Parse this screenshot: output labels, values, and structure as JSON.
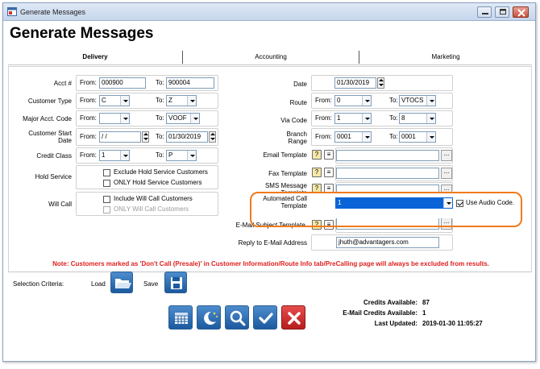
{
  "window": {
    "title": "Generate Messages"
  },
  "page": {
    "heading": "Generate Messages"
  },
  "tabs": [
    {
      "label": "Delivery",
      "active": true
    },
    {
      "label": "Accounting",
      "active": false
    },
    {
      "label": "Marketing",
      "active": false
    }
  ],
  "left": {
    "acct": {
      "label": "Acct #",
      "from_label": "From:",
      "from_value": "000900",
      "to_label": "To:",
      "to_value": "900004"
    },
    "customer_type": {
      "label": "Customer Type",
      "from_label": "From:",
      "from_value": "C",
      "to_label": "To:",
      "to_value": "Z"
    },
    "major_acct_code": {
      "label": "Major Acct. Code",
      "from_label": "From:",
      "from_value": "",
      "to_label": "To:",
      "to_value": "VOOF"
    },
    "customer_start_date": {
      "label_line1": "Customer Start",
      "label_line2": "Date",
      "from_label": "From:",
      "from_value": " / /",
      "to_label": "To:",
      "to_value": "01/30/2019"
    },
    "credit_class": {
      "label": "Credit Class",
      "from_label": "From:",
      "from_value": "1",
      "to_label": "To:",
      "to_value": "P"
    },
    "hold_service": {
      "label": "Hold Service",
      "opt1": "Exclude Hold Service Customers",
      "opt2": "ONLY Hold Service Customers"
    },
    "will_call": {
      "label": "Will Call",
      "opt1": "Include Will Call Customers",
      "opt2": "ONLY Will Call Customers"
    }
  },
  "right": {
    "date": {
      "label": "Date",
      "value": "01/30/2019"
    },
    "route": {
      "label": "Route",
      "from_label": "From:",
      "from_value": "0",
      "to_label": "To:",
      "to_value": "VTOCS"
    },
    "via_code": {
      "label": "Via Code",
      "from_label": "From:",
      "from_value": "1",
      "to_label": "To:",
      "to_value": "8"
    },
    "branch_range": {
      "label_line1": "Branch",
      "label_line2": "Range",
      "from_label": "From:",
      "from_value": "0001",
      "to_label": "To:",
      "to_value": "0001"
    },
    "email_template": {
      "label": "Email Template",
      "dots": "..."
    },
    "fax_template": {
      "label": "Fax Template",
      "dots": "..."
    },
    "sms_template": {
      "label_line1": "SMS Message",
      "label_line2": "Template",
      "dots": "..."
    },
    "automated_call": {
      "label_line1": "Automated Call",
      "label_line2": "Template",
      "value": "1",
      "checkbox_label": "Use Audio Code."
    },
    "email_subject": {
      "label": "E-Mail Subject Template.",
      "dots": "..."
    },
    "reply_to": {
      "label": "Reply to E-Mail Address",
      "value": "jhuth@advantagers.com"
    }
  },
  "note": "Note: Customers marked as 'Don't Call (Presale)' in Customer Information/Route Info tab/PreCalling page will always be excluded from results.",
  "criteria": {
    "label": "Selection Criteria:",
    "load_label": "Load",
    "save_label": "Save"
  },
  "credits": {
    "available_label": "Credits Available:",
    "available_value": "87",
    "email_label": "E-Mail Credits Available:",
    "email_value": "1",
    "updated_label": "Last Updated:",
    "updated_value": "2019-01-30 11:05:27"
  },
  "icons": {
    "window": "window-app-icon",
    "load": "folder-open-icon",
    "save": "floppy-disk-icon",
    "actions": [
      "calendar-grid-icon",
      "moon-stars-icon",
      "search-icon",
      "check-icon",
      "close-icon"
    ]
  },
  "colors": {
    "accent_blue": "#1c5aa0",
    "note_red": "#e02020",
    "highlight_orange": "#f07a1c",
    "selection_blue": "#0a64d8"
  }
}
